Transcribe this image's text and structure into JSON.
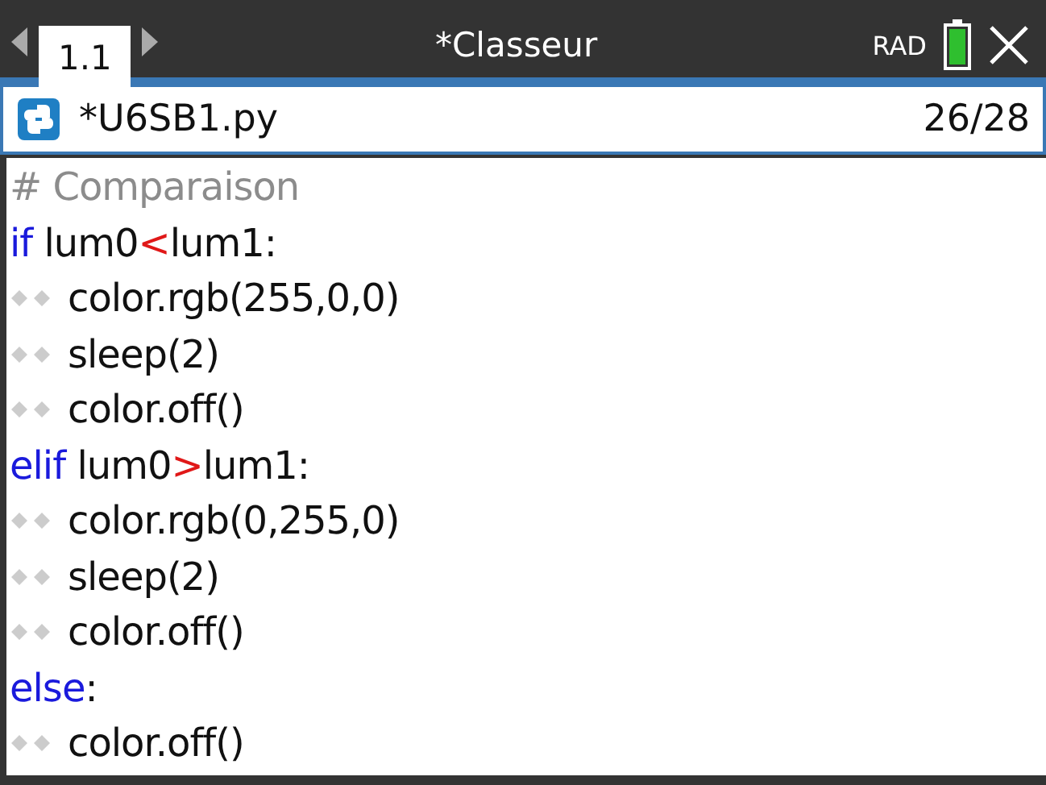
{
  "top_bar": {
    "tab": {
      "label": "1.1",
      "selected": true
    },
    "title": "*Classeur",
    "angle_mode": "RAD"
  },
  "file": {
    "name": "*U6SB1.py",
    "position": "26/28"
  },
  "code_lines": [
    {
      "indented": false,
      "tokens": [
        {
          "kind": "comment",
          "text": "# Comparaison"
        }
      ]
    },
    {
      "indented": false,
      "tokens": [
        {
          "kind": "keyword",
          "text": "if"
        },
        {
          "kind": "plain",
          "text": " lum0"
        },
        {
          "kind": "operator",
          "text": "<"
        },
        {
          "kind": "plain",
          "text": "lum1:"
        }
      ]
    },
    {
      "indented": true,
      "tokens": [
        {
          "kind": "plain",
          "text": "color.rgb(255,0,0)"
        }
      ]
    },
    {
      "indented": true,
      "tokens": [
        {
          "kind": "plain",
          "text": "sleep(2)"
        }
      ]
    },
    {
      "indented": true,
      "tokens": [
        {
          "kind": "plain",
          "text": "color.off()"
        }
      ]
    },
    {
      "indented": false,
      "tokens": [
        {
          "kind": "keyword",
          "text": "elif"
        },
        {
          "kind": "plain",
          "text": " lum0"
        },
        {
          "kind": "operator",
          "text": ">"
        },
        {
          "kind": "plain",
          "text": "lum1:"
        }
      ]
    },
    {
      "indented": true,
      "tokens": [
        {
          "kind": "plain",
          "text": "color.rgb(0,255,0)"
        }
      ]
    },
    {
      "indented": true,
      "tokens": [
        {
          "kind": "plain",
          "text": "sleep(2)"
        }
      ]
    },
    {
      "indented": true,
      "tokens": [
        {
          "kind": "plain",
          "text": "color.off()"
        }
      ]
    },
    {
      "indented": false,
      "tokens": [
        {
          "kind": "keyword",
          "text": "else"
        },
        {
          "kind": "plain",
          "text": ":"
        }
      ]
    },
    {
      "indented": true,
      "tokens": [
        {
          "kind": "plain",
          "text": "color.off()"
        }
      ]
    }
  ]
}
